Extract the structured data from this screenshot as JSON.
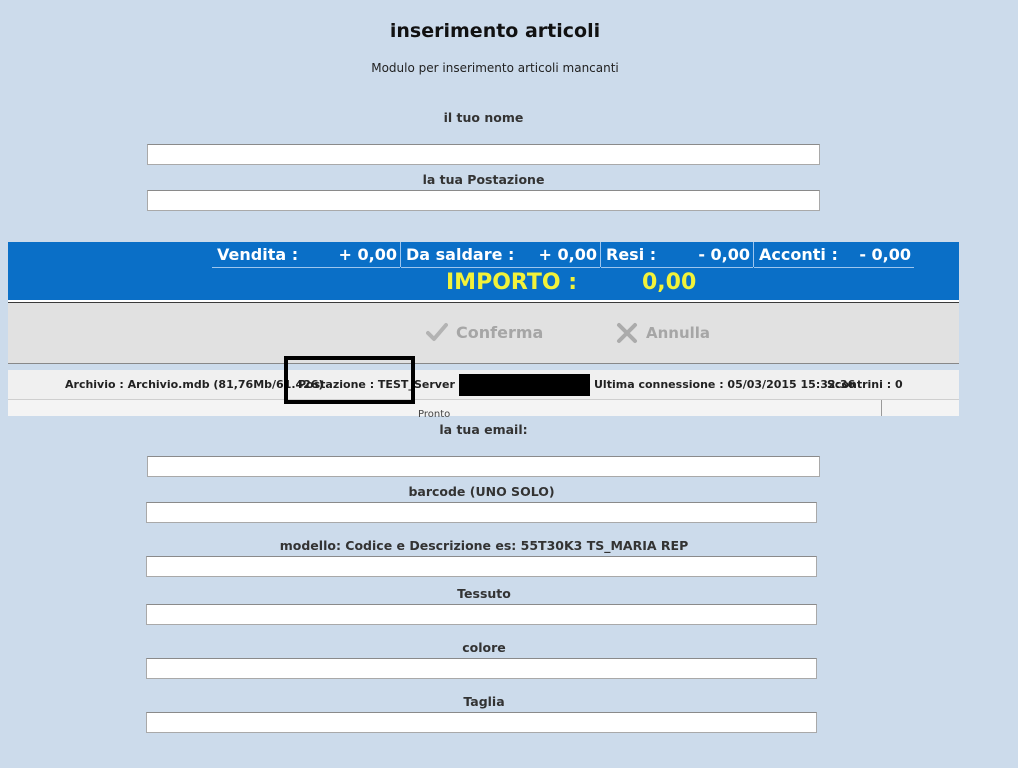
{
  "form": {
    "title": "inserimento articoli",
    "subtitle": "Modulo per inserimento articoli mancanti",
    "fields": {
      "nome": {
        "label": "il tuo nome",
        "value": ""
      },
      "postazione": {
        "label": "la tua Postazione",
        "value": ""
      },
      "email": {
        "label": "la tua email:",
        "value": ""
      },
      "barcode": {
        "label": "barcode (UNO SOLO)",
        "value": ""
      },
      "modello": {
        "label": "modello: Codice e Descrizione es: 55T30K3 TS_MARIA REP",
        "value": ""
      },
      "tessuto": {
        "label": "Tessuto",
        "value": ""
      },
      "colore": {
        "label": "colore",
        "value": ""
      },
      "taglia": {
        "label": "Taglia",
        "value": ""
      }
    }
  },
  "pos": {
    "totals": {
      "vendita": {
        "label": "Vendita :",
        "value": "+ 0,00"
      },
      "da_saldare": {
        "label": "Da saldare :",
        "value": "+ 0,00"
      },
      "resi": {
        "label": "Resi :",
        "value": "- 0,00"
      },
      "acconti": {
        "label": "Acconti :",
        "value": "- 0,00"
      }
    },
    "importo": {
      "label": "IMPORTO :",
      "value": "0,00"
    },
    "buttons": {
      "conferma": "Conferma",
      "annulla": "Annulla"
    },
    "status": {
      "archivio": "Archivio : Archivio.mdb (81,76Mb/61.426)",
      "postazione": "Postazione : TEST_",
      "server": "Server :",
      "ultima_connessione": "Ultima connessione : 05/03/2015 15:32:36",
      "scontrini": "Scontrini : 0"
    },
    "footer_cut_text": "Pronto"
  },
  "colors": {
    "page_bg": "#ccdbeb",
    "totals_bar": "#0a6fc7",
    "importo_text": "#f2f23a",
    "disabled_button": "#a6a6a6"
  }
}
